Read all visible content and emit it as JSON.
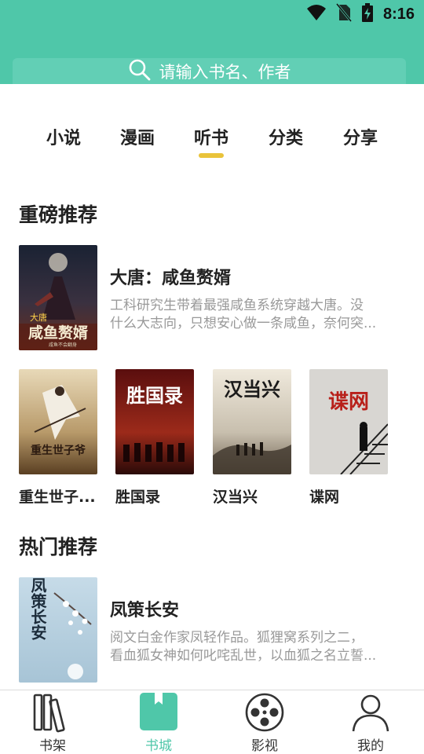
{
  "status_bar": {
    "time": "8:16"
  },
  "search": {
    "placeholder": "请输入书名、作者"
  },
  "tabs": [
    {
      "label": "小说"
    },
    {
      "label": "漫画"
    },
    {
      "label": "听书",
      "active": true
    },
    {
      "label": "分类"
    },
    {
      "label": "分享"
    }
  ],
  "sections": {
    "featured_title": "重磅推荐",
    "hot_title": "热门推荐"
  },
  "featured_book": {
    "title": "大唐：咸鱼赘婿",
    "desc_line1": "工科研究生带着最强咸鱼系统穿越大唐。没",
    "desc_line2": "什么大志向，只想安心做一条咸鱼，奈何突...",
    "cover_text": "咸鱼赘婿",
    "cover_badge": "大唐",
    "cover_author": "咸鱼不会翻身"
  },
  "book_grid": [
    {
      "name": "重生世子爷",
      "display": "重生世子...",
      "cover_text": "重生世子爷"
    },
    {
      "name": "胜国录",
      "display": "胜国录",
      "cover_text": "胜国录"
    },
    {
      "name": "汉当兴",
      "display": "汉当兴",
      "cover_text": "汉当兴"
    },
    {
      "name": "谍网",
      "display": "谍网",
      "cover_text": "谍网"
    }
  ],
  "hot_book": {
    "title": "凤策长安",
    "desc_line1": "阅文白金作家凤轻作品。狐狸窝系列之二，",
    "desc_line2": "看血狐女神如何叱咤乱世，以血狐之名立誓...",
    "cover_text": "凤策长安"
  },
  "bottom_nav": [
    {
      "label": "书架",
      "icon": "bookshelf-icon"
    },
    {
      "label": "书城",
      "icon": "bookstore-icon",
      "active": true
    },
    {
      "label": "影视",
      "icon": "film-reel-icon"
    },
    {
      "label": "我的",
      "icon": "person-icon"
    }
  ],
  "colors": {
    "accent": "#4fc7a9",
    "indicator": "#e9c33a"
  }
}
